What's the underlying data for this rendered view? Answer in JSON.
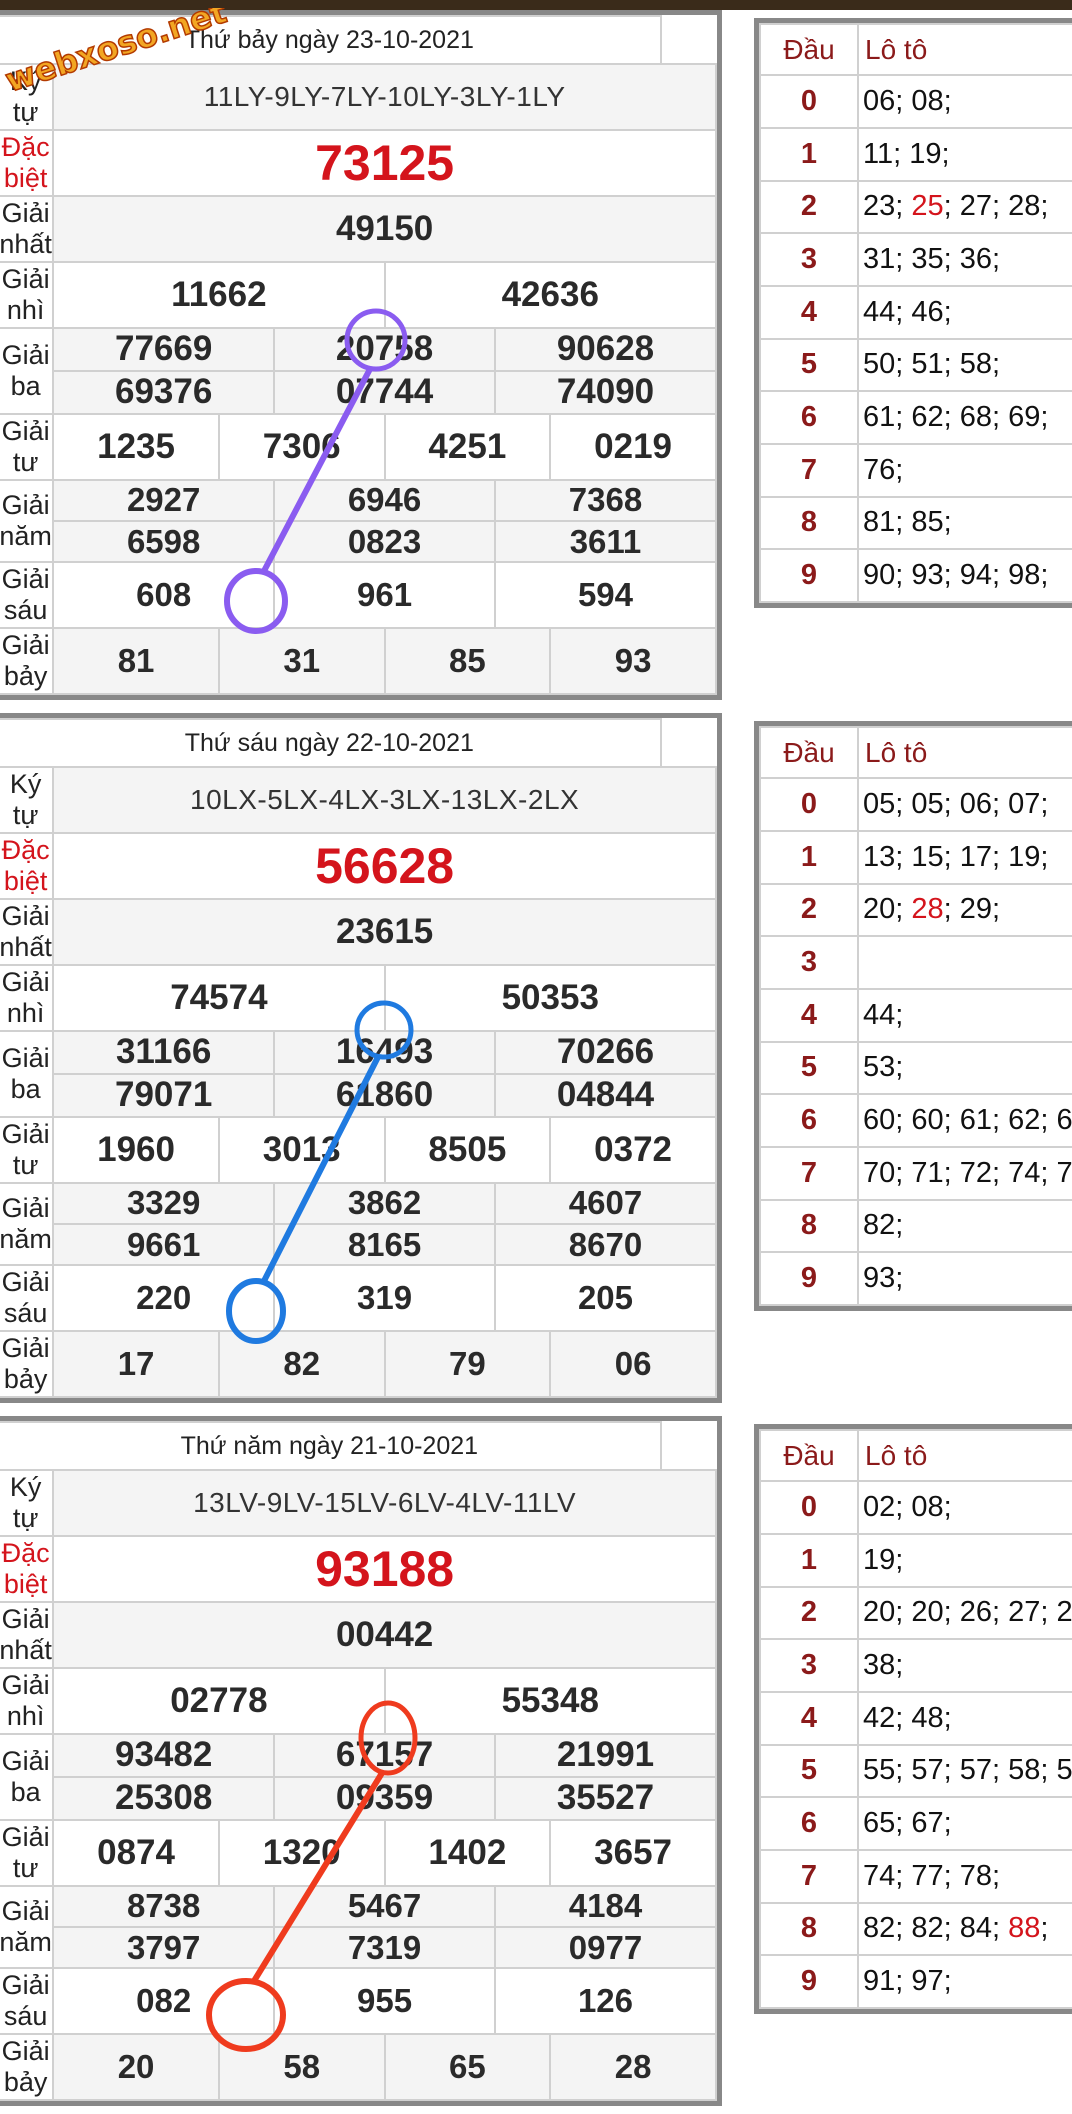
{
  "watermark": "webxoso.net",
  "labels": {
    "ky_tu": "Ký tự",
    "dac_biet": "Đặc biệt",
    "giai_nhat": "Giải nhất",
    "giai_nhi": "Giải nhì",
    "giai_ba": "Giải ba",
    "giai_tu": "Giải tư",
    "giai_nam": "Giải năm",
    "giai_sau": "Giải sáu",
    "giai_bay": "Giải bảy",
    "dau": "Đầu",
    "loto": "Lô tô"
  },
  "colors": {
    "purple": "#8a5cf0",
    "blue": "#1f7ae0",
    "red": "#ef3b1e",
    "special": "#d4141c"
  },
  "days": [
    {
      "title": "Thứ bảy ngày 23-10-2021",
      "ky_tu": "11LY-9LY-7LY-10LY-3LY-1LY",
      "dac_biet": "73125",
      "giai_nhat": "49150",
      "giai_nhi": [
        "11662",
        "42636"
      ],
      "giai_ba": [
        "77669",
        "20758",
        "90628",
        "69376",
        "07744",
        "74090"
      ],
      "giai_tu": [
        "1235",
        "7306",
        "4251",
        "0219"
      ],
      "giai_nam": [
        "2927",
        "6946",
        "7368",
        "6598",
        "0823",
        "3611"
      ],
      "giai_sau": [
        "608",
        "961",
        "594"
      ],
      "giai_bay": [
        "81",
        "31",
        "85",
        "93"
      ],
      "loto": [
        {
          "d": "0",
          "v": "06; 08;"
        },
        {
          "d": "1",
          "v": "11; 19;"
        },
        {
          "d": "2",
          "pre": "23; ",
          "hl": "25",
          "post": "; 27; 28;"
        },
        {
          "d": "3",
          "v": "31; 35; 36;"
        },
        {
          "d": "4",
          "v": "44; 46;"
        },
        {
          "d": "5",
          "v": "50; 51; 58;"
        },
        {
          "d": "6",
          "v": "61; 62; 68; 69;"
        },
        {
          "d": "7",
          "v": "76;"
        },
        {
          "d": "8",
          "v": "81; 85;"
        },
        {
          "d": "9",
          "v": "90; 93; 94; 98;"
        }
      ]
    },
    {
      "title": "Thứ sáu ngày 22-10-2021",
      "ky_tu": "10LX-5LX-4LX-3LX-13LX-2LX",
      "dac_biet": "56628",
      "giai_nhat": "23615",
      "giai_nhi": [
        "74574",
        "50353"
      ],
      "giai_ba": [
        "31166",
        "16493",
        "70266",
        "79071",
        "61860",
        "04844"
      ],
      "giai_tu": [
        "1960",
        "3013",
        "8505",
        "0372"
      ],
      "giai_nam": [
        "3329",
        "3862",
        "4607",
        "9661",
        "8165",
        "8670"
      ],
      "giai_sau": [
        "220",
        "319",
        "205"
      ],
      "giai_bay": [
        "17",
        "82",
        "79",
        "06"
      ],
      "loto": [
        {
          "d": "0",
          "v": "05; 05; 06; 07;"
        },
        {
          "d": "1",
          "v": "13; 15; 17; 19;"
        },
        {
          "d": "2",
          "pre": "20; ",
          "hl": "28",
          "post": "; 29;"
        },
        {
          "d": "3",
          "v": ""
        },
        {
          "d": "4",
          "v": "44;"
        },
        {
          "d": "5",
          "v": "53;"
        },
        {
          "d": "6",
          "v": "60; 60; 61; 62; 6"
        },
        {
          "d": "7",
          "v": "70; 71; 72; 74; 7"
        },
        {
          "d": "8",
          "v": "82;"
        },
        {
          "d": "9",
          "v": "93;"
        }
      ]
    },
    {
      "title": "Thứ năm ngày 21-10-2021",
      "ky_tu": "13LV-9LV-15LV-6LV-4LV-11LV",
      "dac_biet": "93188",
      "giai_nhat": "00442",
      "giai_nhi": [
        "02778",
        "55348"
      ],
      "giai_ba": [
        "93482",
        "67157",
        "21991",
        "25308",
        "09359",
        "35527"
      ],
      "giai_tu": [
        "0874",
        "1320",
        "1402",
        "3657"
      ],
      "giai_nam": [
        "8738",
        "5467",
        "4184",
        "3797",
        "7319",
        "0977"
      ],
      "giai_sau": [
        "082",
        "955",
        "126"
      ],
      "giai_bay": [
        "20",
        "58",
        "65",
        "28"
      ],
      "loto": [
        {
          "d": "0",
          "v": "02; 08;"
        },
        {
          "d": "1",
          "v": "19;"
        },
        {
          "d": "2",
          "v": "20; 20; 26; 27; 2"
        },
        {
          "d": "3",
          "v": "38;"
        },
        {
          "d": "4",
          "v": "42; 48;"
        },
        {
          "d": "5",
          "v": "55; 57; 57; 58; 5"
        },
        {
          "d": "6",
          "v": "65; 67;"
        },
        {
          "d": "7",
          "v": "74; 77; 78;"
        },
        {
          "d": "8",
          "pre": "82; 82; 84; ",
          "hl": "88",
          "post": ";"
        },
        {
          "d": "9",
          "v": "91; 97;"
        }
      ]
    }
  ]
}
